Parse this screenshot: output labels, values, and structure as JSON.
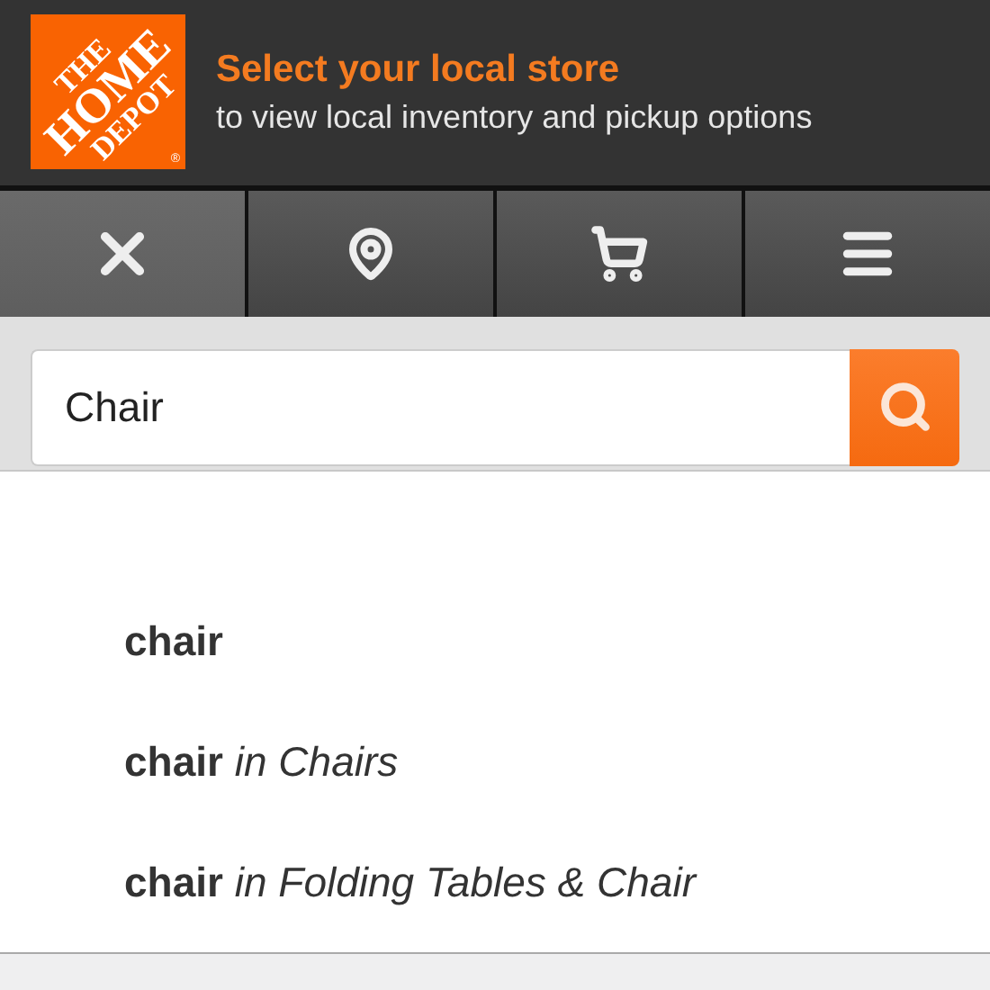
{
  "header": {
    "logo": {
      "lines": [
        "THE",
        "HOME",
        "DEPOT"
      ],
      "mark": "®"
    },
    "title": "Select your local store",
    "subtitle": "to view local inventory and pickup options"
  },
  "nav": [
    {
      "kind": "close",
      "selected": true
    },
    {
      "kind": "location",
      "selected": false
    },
    {
      "kind": "cart",
      "selected": false
    },
    {
      "kind": "menu",
      "selected": false
    }
  ],
  "search": {
    "value": "Chair"
  },
  "suggestions": [
    "**chair**",
    "**chair** *in Chairs*",
    "**chair** *in Folding Tables & Chair*"
  ]
}
